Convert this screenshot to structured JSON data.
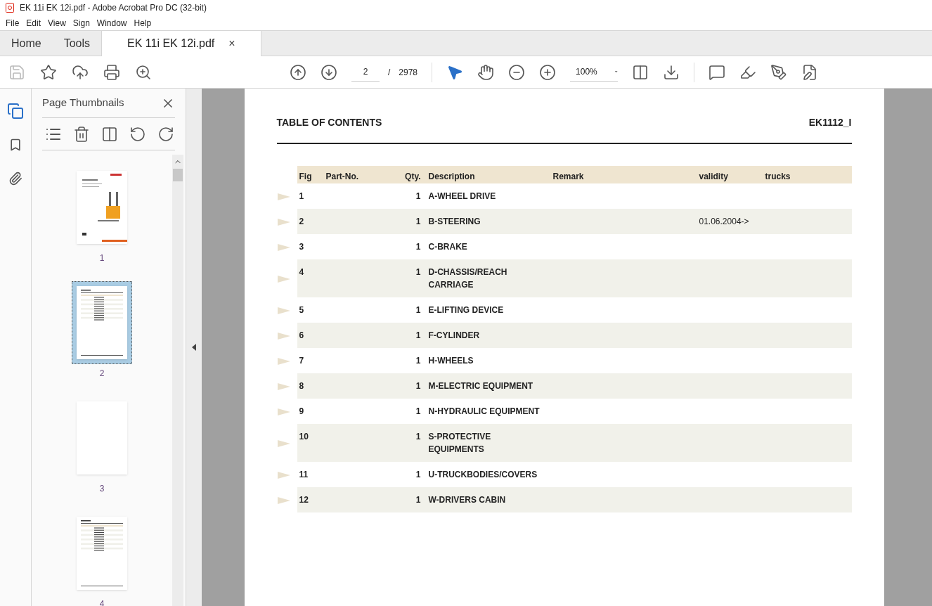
{
  "window": {
    "title": "EK 11i EK 12i.pdf - Adobe Acrobat Pro DC (32-bit)"
  },
  "menu": [
    "File",
    "Edit",
    "View",
    "Sign",
    "Window",
    "Help"
  ],
  "tabs": [
    {
      "label": "Home",
      "selected": false
    },
    {
      "label": "Tools",
      "selected": false
    },
    {
      "label": "EK 11i EK 12i.pdf",
      "selected": true,
      "kind": "document",
      "close": "×"
    }
  ],
  "toolbar": {
    "page": "2",
    "page_sep": "/",
    "page_count": "2978",
    "zoom": "100%"
  },
  "panel": {
    "title": "Page Thumbnails",
    "thumbnails": [
      {
        "label": "1",
        "kind": "cover",
        "selected": false
      },
      {
        "label": "2",
        "kind": "table",
        "selected": true
      },
      {
        "label": "3",
        "kind": "blank",
        "selected": false
      },
      {
        "label": "4",
        "kind": "table",
        "selected": false
      }
    ]
  },
  "document": {
    "heading": "TABLE OF CONTENTS",
    "code": "EK1112_I",
    "columns": [
      "Fig",
      "Part-No.",
      "Qty.",
      "Description",
      "Remark",
      "validity",
      "trucks"
    ],
    "rows": [
      {
        "fig": "1",
        "qty": "1",
        "description_lines": [
          "A-WHEEL DRIVE"
        ]
      },
      {
        "fig": "2",
        "qty": "1",
        "description_lines": [
          "B-STEERING"
        ],
        "validity": "01.06.2004->"
      },
      {
        "fig": "3",
        "qty": "1",
        "description_lines": [
          "C-BRAKE"
        ]
      },
      {
        "fig": "4",
        "qty": "1",
        "description_lines": [
          "D-CHASSIS/REACH",
          "CARRIAGE"
        ]
      },
      {
        "fig": "5",
        "qty": "1",
        "description_lines": [
          "E-LIFTING DEVICE"
        ]
      },
      {
        "fig": "6",
        "qty": "1",
        "description_lines": [
          "F-CYLINDER"
        ]
      },
      {
        "fig": "7",
        "qty": "1",
        "description_lines": [
          "H-WHEELS"
        ]
      },
      {
        "fig": "8",
        "qty": "1",
        "description_lines": [
          "M-ELECTRIC EQUIPMENT"
        ]
      },
      {
        "fig": "9",
        "qty": "1",
        "description_lines": [
          "N-HYDRAULIC EQUIPMENT"
        ]
      },
      {
        "fig": "10",
        "qty": "1",
        "description_lines": [
          "S-PROTECTIVE",
          "EQUIPMENTS"
        ]
      },
      {
        "fig": "11",
        "qty": "1",
        "description_lines": [
          "U-TRUCKBODIES/COVERS"
        ]
      },
      {
        "fig": "12",
        "qty": "1",
        "description_lines": [
          "W-DRIVERS CABIN"
        ]
      }
    ]
  }
}
